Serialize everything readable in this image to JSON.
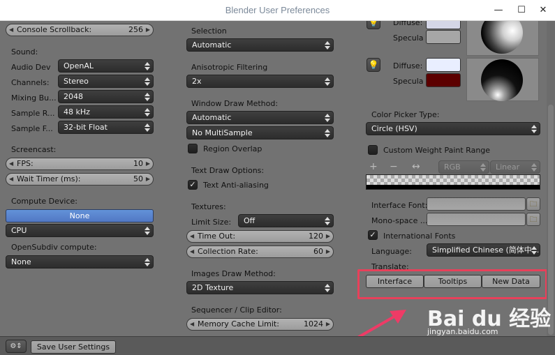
{
  "window": {
    "title": "Blender User Preferences",
    "minimize": "—",
    "maximize": "☐",
    "close": "✕"
  },
  "col1": {
    "console_scrollback": {
      "label": "Console Scrollback:",
      "value": "256"
    },
    "sound_header": "Sound:",
    "audio_dev": {
      "label": "Audio Dev",
      "value": "OpenAL"
    },
    "channels": {
      "label": "Channels:",
      "value": "Stereo"
    },
    "mixing_buffer": {
      "label": "Mixing Bu...",
      "value": "2048"
    },
    "sample_rate": {
      "label": "Sample R...",
      "value": "48 kHz"
    },
    "sample_format": {
      "label": "Sample F...",
      "value": "32-bit Float"
    },
    "screencast_header": "Screencast:",
    "fps": {
      "label": "FPS:",
      "value": "10"
    },
    "wait_timer": {
      "label": "Wait Timer (ms):",
      "value": "50"
    },
    "compute_header": "Compute Device:",
    "compute_none": "None",
    "compute_cpu": "CPU",
    "opensubdiv_header": "OpenSubdiv compute:",
    "opensubdiv_value": "None"
  },
  "col2": {
    "selection_header": "Selection",
    "selection_value": "Automatic",
    "aniso_header": "Anisotropic Filtering",
    "aniso_value": "2x",
    "window_draw_header": "Window Draw Method:",
    "window_draw_value": "Automatic",
    "multisample_value": "No MultiSample",
    "region_overlap": "Region Overlap",
    "text_draw_header": "Text Draw Options:",
    "text_antialias": "Text Anti-aliasing",
    "textures_header": "Textures:",
    "limit_size_label": "Limit Size:",
    "limit_size_value": "Off",
    "time_out": {
      "label": "Time Out:",
      "value": "120"
    },
    "collection_rate": {
      "label": "Collection Rate:",
      "value": "60"
    },
    "images_draw_header": "Images Draw Method:",
    "images_draw_value": "2D Texture",
    "sequencer_header": "Sequencer / Clip Editor:",
    "memory_cache": {
      "label": "Memory Cache Limit:",
      "value": "1024"
    }
  },
  "col3": {
    "diffuse1": "Diffuse:",
    "specular1": "Specula",
    "diffuse2": "Diffuse:",
    "specular2": "Specula",
    "colors": {
      "diffuse1": "#d4d6e6",
      "specular1": "#a6a6a6",
      "diffuse2": "#e9eeff",
      "specular2": "#5c0000"
    },
    "color_picker_header": "Color Picker Type:",
    "color_picker_value": "Circle (HSV)",
    "custom_weight": "Custom Weight Paint Range",
    "ramp_mode": "RGB",
    "ramp_interp": "Linear",
    "interface_font_label": "Interface Font:",
    "monospace_font_label": "Mono-space ...",
    "intl_fonts": "International Fonts",
    "language_label": "Language:",
    "language_value": "Simplified Chinese (简体中...",
    "translate_label": "Translate:",
    "translate_buttons": [
      "Interface",
      "Tooltips",
      "New Data"
    ]
  },
  "footer": {
    "save_label": "Save User Settings"
  },
  "watermark": {
    "brand": "Bai du 经验",
    "url": "jingyan.baidu.com"
  },
  "accent": {
    "highlight": "#e8405a",
    "arrow": "#ee3b66",
    "compute_blue": "#5b86d0"
  }
}
